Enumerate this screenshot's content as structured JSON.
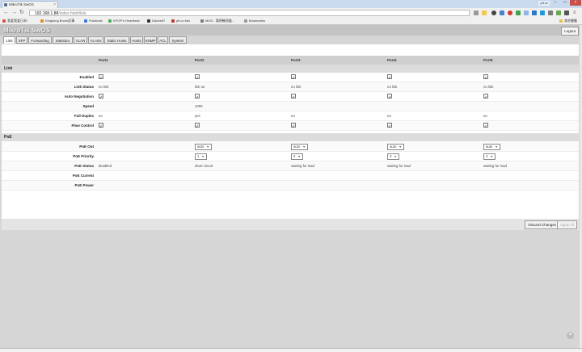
{
  "browser": {
    "tab_title": "MikroTik SwOS",
    "url_host": "192.168.1.88",
    "url_path": "/index.html#link",
    "user_badge": "ptt.cc",
    "bookmarks": [
      {
        "label": "我爱我爱日本!",
        "color": "#d9534f"
      },
      {
        "label": "Kingkong Bruce記事",
        "color": "#e58f2a"
      },
      {
        "label": "Pushmail",
        "color": "#3c7bd6"
      },
      {
        "label": "KPOP's Heartbeat",
        "color": "#4caf50"
      },
      {
        "label": "Daobe87",
        "color": "#333333"
      },
      {
        "label": "ptt.cc.bbs",
        "color": "#c0392b"
      },
      {
        "label": "MOD - 電視機頂盒...",
        "color": "#7b7b7b"
      },
      {
        "label": "Bookmarks",
        "color": "#999999"
      }
    ],
    "other_bookmarks": "其他書籤"
  },
  "app": {
    "brand": "MikroTik SwOS",
    "logout_label": "Logout",
    "tabs": [
      "Link",
      "SFP",
      "Forwarding",
      "Statistics",
      "VLAN",
      "VLANs",
      "Static Hosts",
      "Hosts",
      "SNMP",
      "ACL",
      "System"
    ],
    "active_tab": "Link",
    "ports": [
      "Port1",
      "Port2",
      "Port3",
      "Port4",
      "Port5"
    ],
    "link_section": "Link",
    "poe_section": "PoE",
    "rows": {
      "enabled": {
        "label": "Enabled",
        "values": [
          true,
          true,
          true,
          true,
          true
        ]
      },
      "link_status": {
        "label": "Link Status",
        "values": [
          "no link",
          "link on",
          "no link",
          "no link",
          "no link"
        ]
      },
      "auto_negotiation": {
        "label": "Auto Negotiation",
        "values": [
          true,
          true,
          true,
          true,
          true
        ]
      },
      "speed": {
        "label": "Speed",
        "values": [
          "",
          "1000",
          "",
          "",
          ""
        ]
      },
      "full_duplex": {
        "label": "Full Duplex",
        "values": [
          "no",
          "yes",
          "no",
          "no",
          "no"
        ]
      },
      "flow_control": {
        "label": "Flow Control",
        "values": [
          true,
          true,
          true,
          true,
          true
        ]
      },
      "poe_out": {
        "label": "PoE Out",
        "values": [
          "",
          "auto",
          "auto",
          "auto",
          "auto"
        ]
      },
      "poe_priority": {
        "label": "PoE Priority",
        "values": [
          "",
          "1",
          "2",
          "3",
          "4"
        ]
      },
      "poe_status": {
        "label": "PoE Status",
        "values": [
          "disabled",
          "short circuit",
          "waiting for load",
          "waiting for load",
          "waiting for load"
        ]
      },
      "poe_current": {
        "label": "PoE Current"
      },
      "poe_power": {
        "label": "PoE Power"
      }
    },
    "discard_label": "Discard Changes",
    "apply_label": "Apply All"
  }
}
